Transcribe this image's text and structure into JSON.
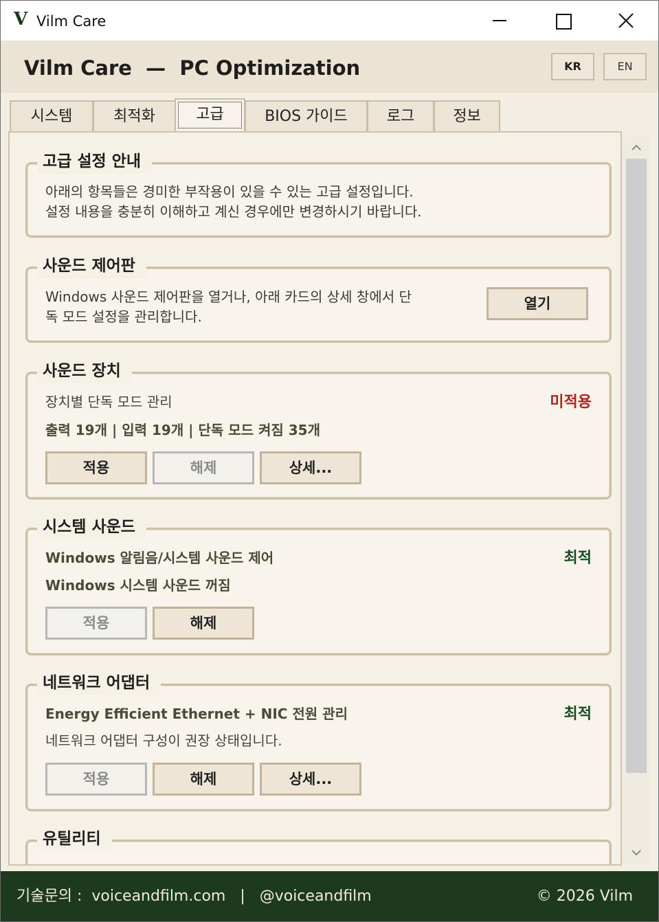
{
  "window": {
    "logo": "V",
    "title": "Vilm Care"
  },
  "header": {
    "title": "Vilm Care  —  PC Optimization",
    "lang_kr": "KR",
    "lang_en": "EN"
  },
  "tabs": [
    {
      "label": "시스템"
    },
    {
      "label": "최적화"
    },
    {
      "label": "고급"
    },
    {
      "label": "BIOS 가이드"
    },
    {
      "label": "로그"
    },
    {
      "label": "정보"
    }
  ],
  "advanced_notice": {
    "title": "고급 설정 안내",
    "line1": "아래의 항목들은 경미한 부작용이 있을 수 있는 고급 설정입니다.",
    "line2": "설정 내용을 충분히 이해하고 계신 경우에만 변경하시기 바랍니다."
  },
  "sound_panel": {
    "title": "사운드 제어판",
    "line1": "Windows 사운드 제어판을 열거나, 아래 카드의 상세 창에서 단",
    "line2": "독 모드 설정을 관리합니다.",
    "open_button": "열기"
  },
  "sound_devices": {
    "title": "사운드 장치",
    "line1": "장치별 단독 모드 관리",
    "line2": "출력 19개 | 입력 19개 | 단독 모드 켜짐 35개",
    "status": "미적용",
    "apply_button": "적용",
    "revert_button": "해제",
    "detail_button": "상세..."
  },
  "system_sound": {
    "title": "시스템 사운드",
    "line1": "Windows 알림음/시스템 사운드 제어",
    "line2": "Windows 시스템 사운드 꺼짐",
    "status": "최적",
    "apply_button": "적용",
    "revert_button": "해제"
  },
  "network_adapter": {
    "title": "네트워크 어댑터",
    "line1": "Energy Efficient Ethernet + NIC 전원 관리",
    "line2": "네트워크 어댑터 구성이 권장 상태입니다.",
    "status": "최적",
    "apply_button": "적용",
    "revert_button": "해제",
    "detail_button": "상세..."
  },
  "utility": {
    "title": "유틸리티"
  },
  "footer": {
    "contact": "기술문의 :  voiceandfilm.com   |   @voiceandfilm",
    "copyright": "© 2026 Vilm"
  },
  "colors": {
    "brand_green": "#1d3a1f",
    "status_red": "#b22222",
    "status_green": "#1b4b24",
    "background": "#f3eee3"
  },
  "icons": [
    "logo-v-icon",
    "minimize-icon",
    "maximize-icon",
    "close-icon",
    "chevron-up-icon",
    "chevron-down-icon"
  ]
}
